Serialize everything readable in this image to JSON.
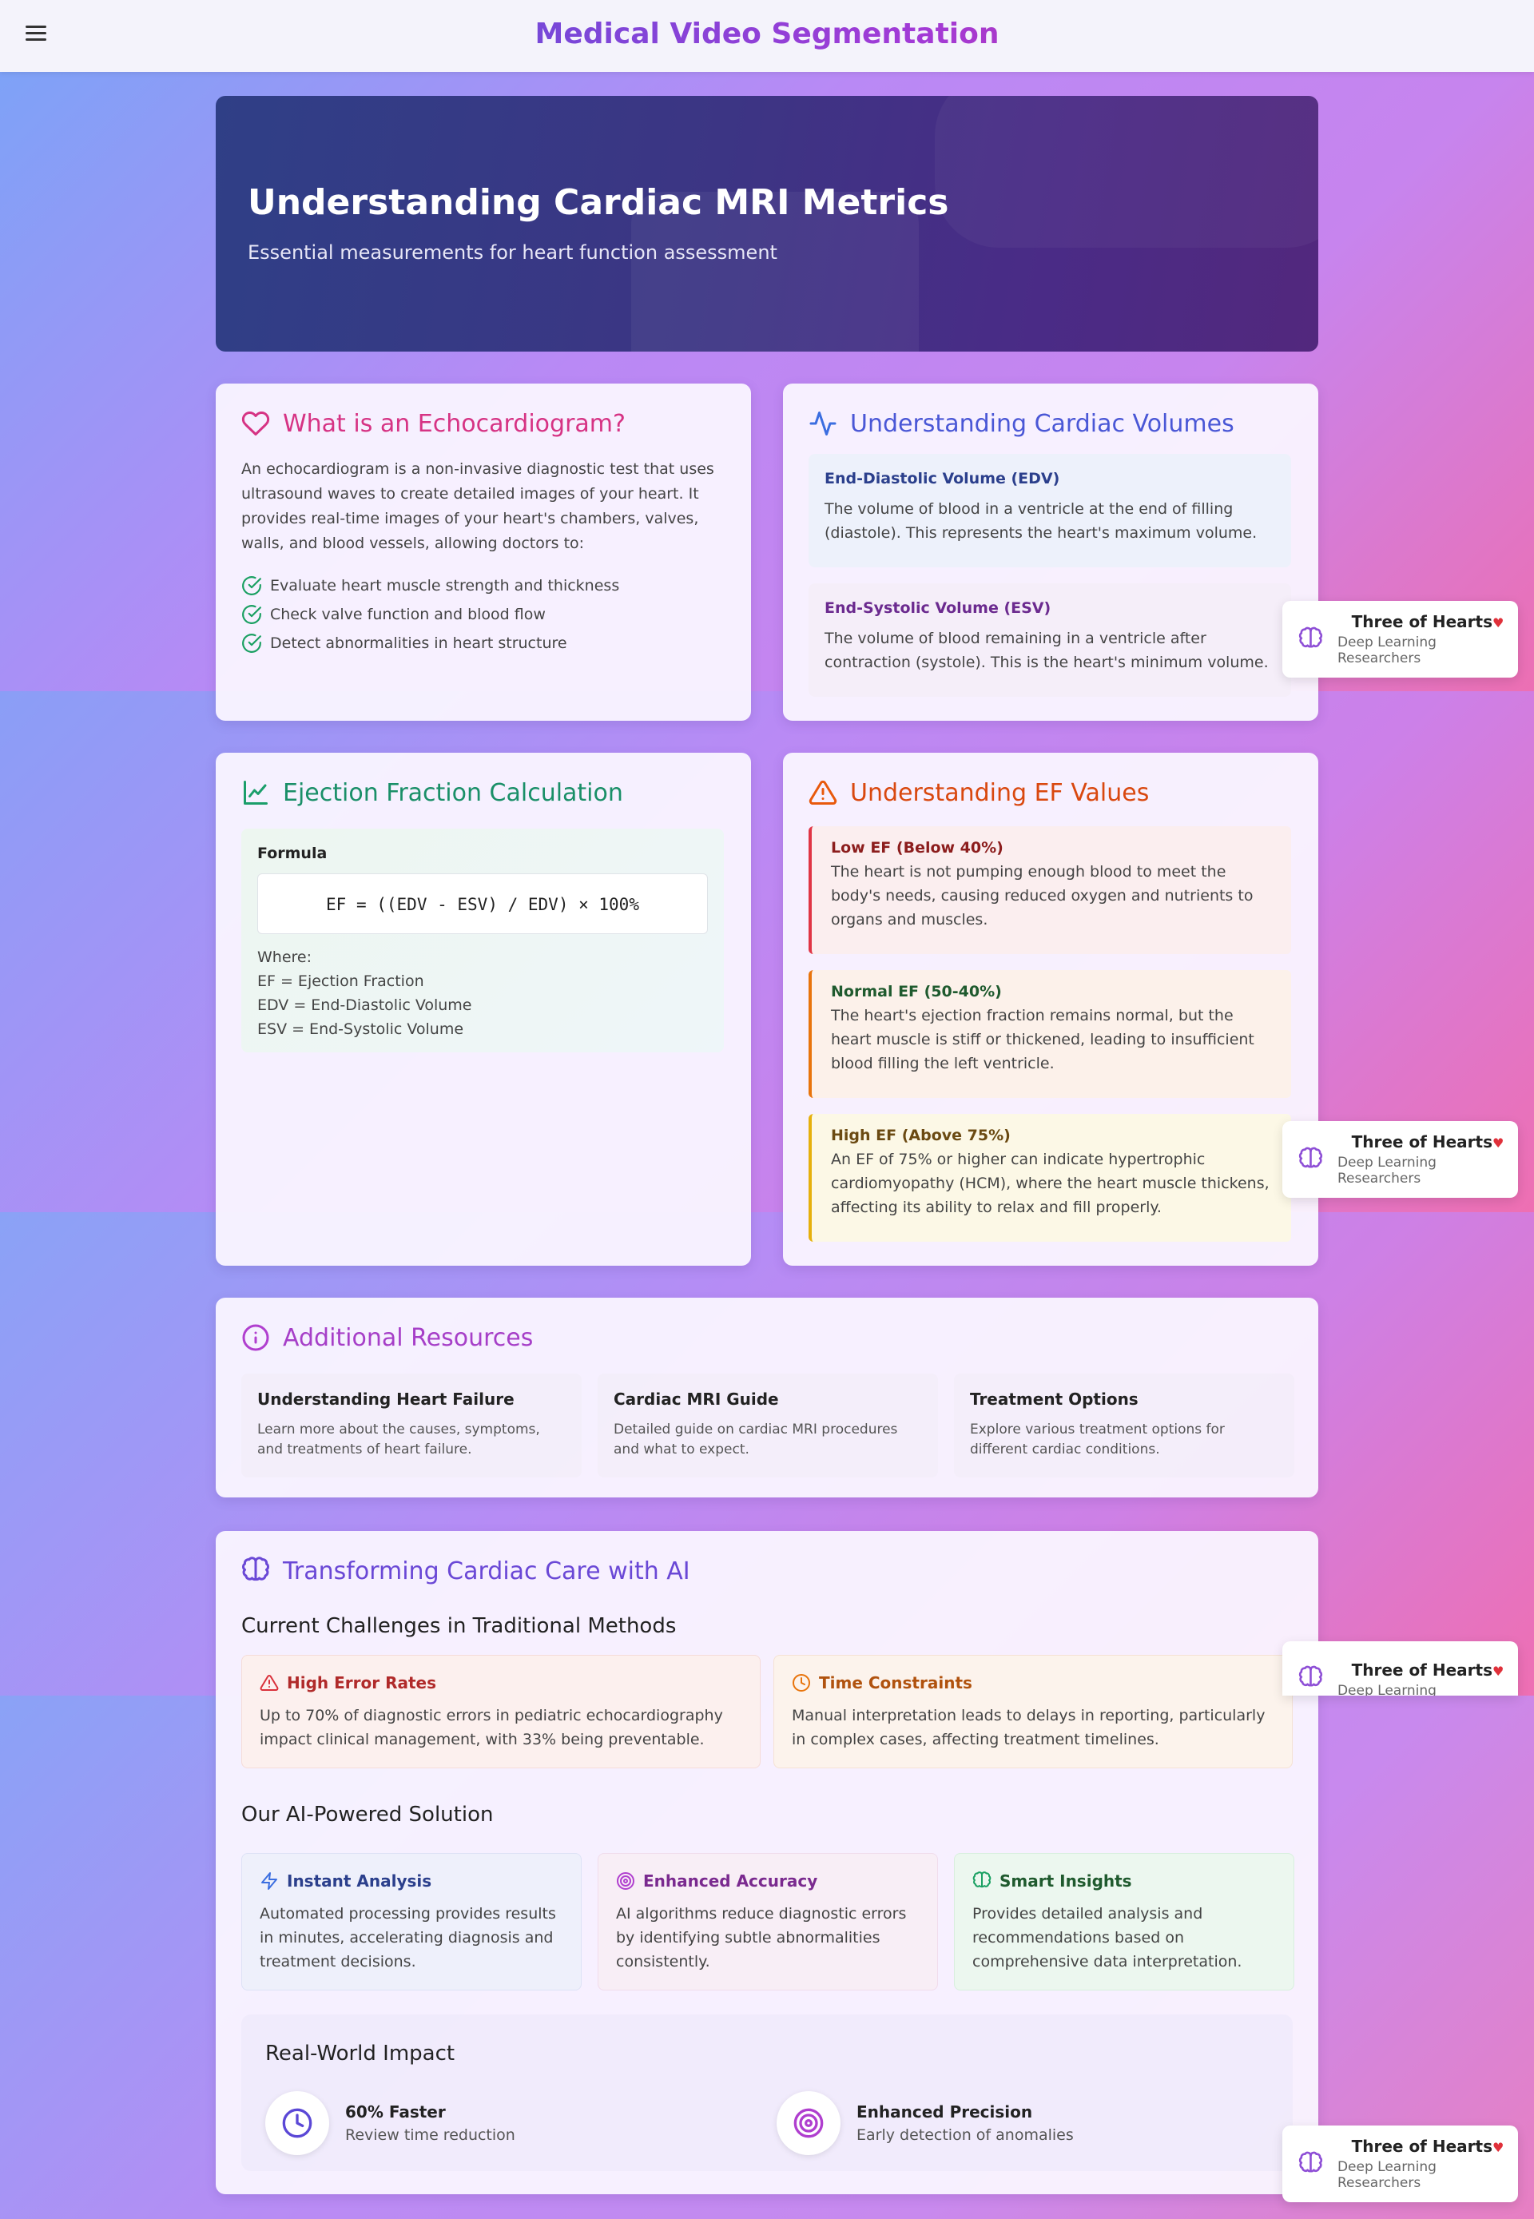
{
  "header": {
    "title": "Medical Video Segmentation"
  },
  "hero": {
    "title": "Understanding Cardiac MRI Metrics",
    "subtitle": "Essential measurements for heart function assessment"
  },
  "echo": {
    "title": "What is an Echocardiogram?",
    "text": "An echocardiogram is a non-invasive diagnostic test that uses ultrasound waves to create detailed images of your heart. It provides real-time images of your heart's chambers, valves, walls, and blood vessels, allowing doctors to:",
    "items": [
      "Evaluate heart muscle strength and thickness",
      "Check valve function and blood flow",
      "Detect abnormalities in heart structure"
    ]
  },
  "volumes": {
    "title": "Understanding Cardiac Volumes",
    "edv_title": "End-Diastolic Volume (EDV)",
    "edv_text": "The volume of blood in a ventricle at the end of filling (diastole). This represents the heart's maximum volume.",
    "esv_title": "End-Systolic Volume (ESV)",
    "esv_text": "The volume of blood remaining in a ventricle after contraction (systole). This is the heart's minimum volume."
  },
  "ejection": {
    "title": "Ejection Fraction Calculation",
    "formula_label": "Formula",
    "formula": "EF = ((EDV - ESV) / EDV) × 100%",
    "where": "Where:",
    "defs": [
      "EF = Ejection Fraction",
      "EDV = End-Diastolic Volume",
      "ESV = End-Systolic Volume"
    ]
  },
  "ef_values": {
    "title": "Understanding EF Values",
    "low_title": "Low EF (Below 40%)",
    "low_text": "The heart is not pumping enough blood to meet the body's needs, causing reduced oxygen and nutrients to organs and muscles.",
    "normal_title": "Normal EF (50-40%)",
    "normal_text": "The heart's ejection fraction remains normal, but the heart muscle is stiff or thickened, leading to insufficient blood filling the left ventricle.",
    "high_title": "High EF (Above 75%)",
    "high_text": "An EF of 75% or higher can indicate hypertrophic cardiomyopathy (HCM), where the heart muscle thickens, affecting its ability to relax and fill properly."
  },
  "resources": {
    "title": "Additional Resources",
    "items": [
      {
        "title": "Understanding Heart Failure",
        "text": "Learn more about the causes, symptoms, and treatments of heart failure."
      },
      {
        "title": "Cardiac MRI Guide",
        "text": "Detailed guide on cardiac MRI procedures and what to expect."
      },
      {
        "title": "Treatment Options",
        "text": "Explore various treatment options for different cardiac conditions."
      }
    ]
  },
  "ai": {
    "title": "Transforming Cardiac Care with AI",
    "challenges_heading": "Current Challenges in Traditional Methods",
    "challenges": [
      {
        "title": "High Error Rates",
        "text": "Up to 70% of diagnostic errors in pediatric echocardiography impact clinical management, with 33% being preventable."
      },
      {
        "title": "Time Constraints",
        "text": "Manual interpretation leads to delays in reporting, particularly in complex cases, affecting treatment timelines."
      }
    ],
    "solution_heading": "Our AI-Powered Solution",
    "solutions": [
      {
        "title": "Instant Analysis",
        "text": "Automated processing provides results in minutes, accelerating diagnosis and treatment decisions."
      },
      {
        "title": "Enhanced Accuracy",
        "text": "AI algorithms reduce diagnostic errors by identifying subtle abnormalities consistently."
      },
      {
        "title": "Smart Insights",
        "text": "Provides detailed analysis and recommendations based on comprehensive data interpretation."
      }
    ],
    "impact_heading": "Real-World Impact",
    "impact": [
      {
        "title": "60% Faster",
        "text": "Review time reduction"
      },
      {
        "title": "Enhanced Precision",
        "text": "Early detection of anomalies"
      }
    ]
  },
  "badge": {
    "title": "Three of Hearts",
    "subtitle": "Deep Learning Researchers"
  },
  "colors": {
    "pink": "#d63384",
    "indigo": "#5b48d6",
    "green": "#1a9e6a",
    "orange": "#e8590c",
    "purple": "#b03fcf"
  }
}
